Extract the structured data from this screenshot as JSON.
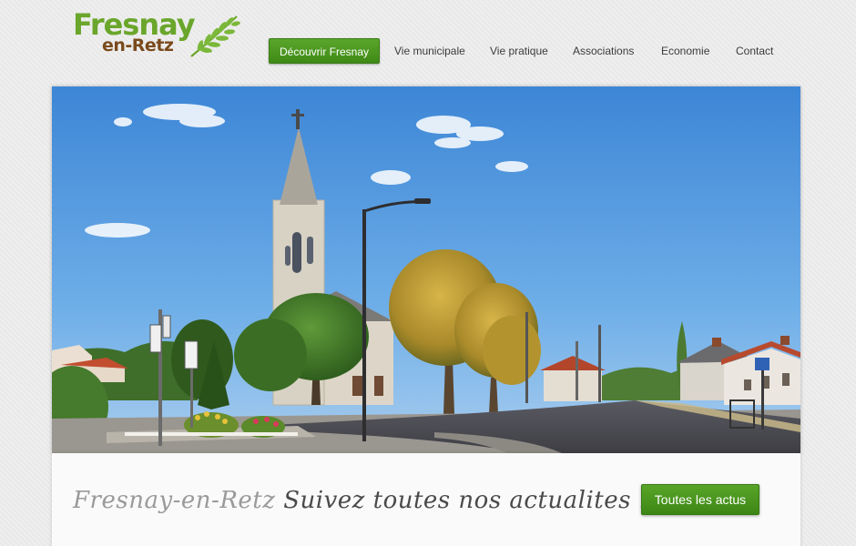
{
  "logo": {
    "line1": "Fresnay",
    "line2": "en-Retz",
    "icon": "leaf-branch-icon",
    "colors": {
      "green": "#6aa62b",
      "brown": "#7a4a1c",
      "dot": "#4aa6c8"
    }
  },
  "nav": {
    "items": [
      {
        "label": "Découvrir Fresnay",
        "active": true
      },
      {
        "label": "Vie municipale",
        "active": false
      },
      {
        "label": "Vie pratique",
        "active": false
      },
      {
        "label": "Associations",
        "active": false
      },
      {
        "label": "Economie",
        "active": false
      },
      {
        "label": "Contact",
        "active": false
      }
    ]
  },
  "hero": {
    "subject": "village-church-street-photo"
  },
  "tagline": {
    "brand": "Fresnay-en-Retz",
    "text": "Suivez toutes nos actualites !"
  },
  "actions": {
    "all_news_label": "Toutes les actus"
  },
  "colors": {
    "accent_green": "#4a9a20",
    "sky": "#4f97dc"
  }
}
